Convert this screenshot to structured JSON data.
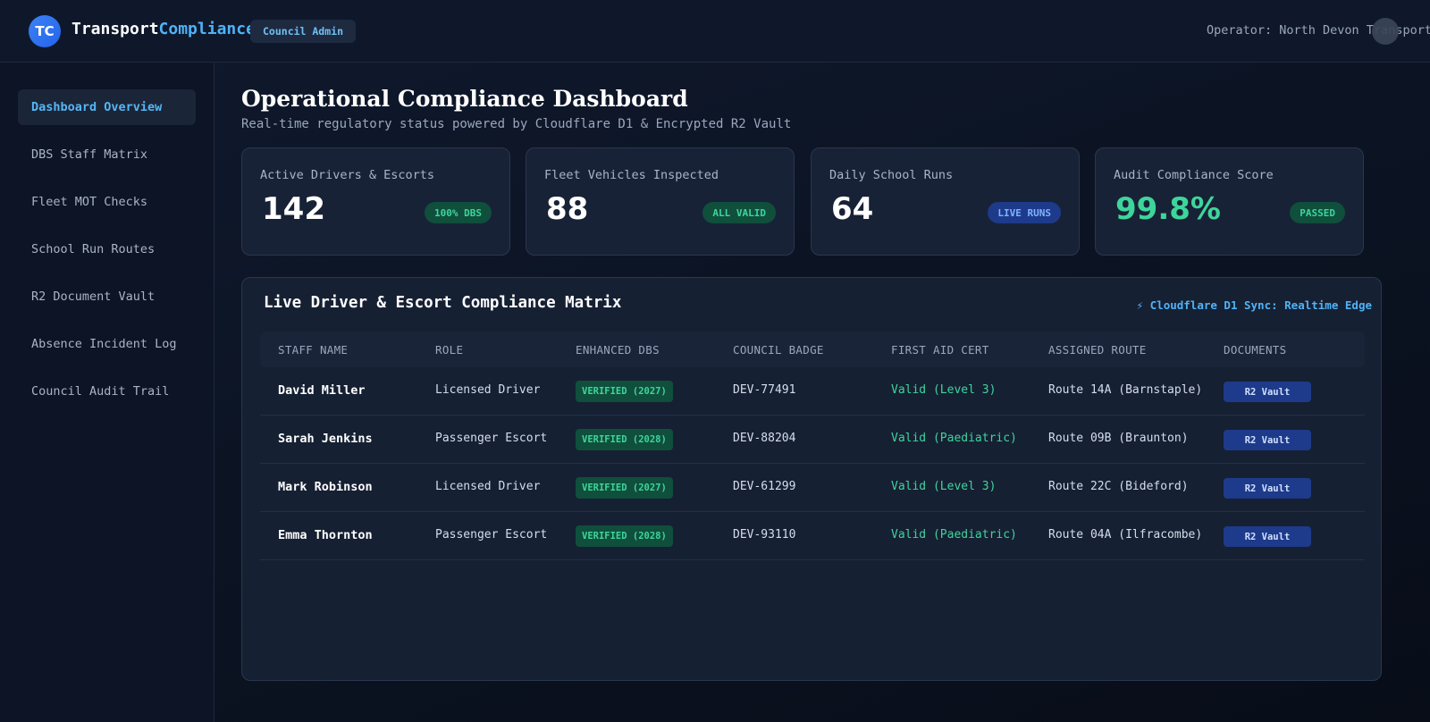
{
  "header": {
    "logo_initials": "TC",
    "brand_primary": "Transport",
    "brand_accent": "Compliance",
    "role_badge": "Council Admin",
    "operator": "Operator: North Devon Transport"
  },
  "sidebar": {
    "items": [
      {
        "label": "Dashboard Overview",
        "active": true
      },
      {
        "label": "DBS Staff Matrix",
        "active": false
      },
      {
        "label": "Fleet MOT Checks",
        "active": false
      },
      {
        "label": "School Run Routes",
        "active": false
      },
      {
        "label": "R2 Document Vault",
        "active": false
      },
      {
        "label": "Absence Incident Log",
        "active": false
      },
      {
        "label": "Council Audit Trail",
        "active": false
      }
    ]
  },
  "page": {
    "title": "Operational Compliance Dashboard",
    "subtitle": "Real-time regulatory status powered by Cloudflare D1 & Encrypted R2 Vault"
  },
  "stats": [
    {
      "label": "Active Drivers & Escorts",
      "value": "142",
      "badge": "100% DBS",
      "badge_color": "green"
    },
    {
      "label": "Fleet Vehicles Inspected",
      "value": "88",
      "badge": "ALL VALID",
      "badge_color": "green"
    },
    {
      "label": "Daily School Runs",
      "value": "64",
      "badge": "LIVE RUNS",
      "badge_color": "blue"
    },
    {
      "label": "Audit Compliance Score",
      "value": "99.8%",
      "badge": "PASSED",
      "badge_color": "green"
    }
  ],
  "matrix": {
    "title": "Live Driver & Escort Compliance Matrix",
    "sync_label": "⚡ Cloudflare D1 Sync: Realtime Edge",
    "columns": [
      "STAFF NAME",
      "ROLE",
      "ENHANCED DBS",
      "COUNCIL BADGE",
      "FIRST AID CERT",
      "ASSIGNED ROUTE",
      "DOCUMENTS"
    ],
    "rows": [
      {
        "name": "David Miller",
        "role": "Licensed Driver",
        "dbs": "VERIFIED (2027)",
        "badge": "DEV-77491",
        "first_aid": "Valid (Level 3)",
        "route": "Route 14A (Barnstaple)",
        "documents": "R2 Vault"
      },
      {
        "name": "Sarah Jenkins",
        "role": "Passenger Escort",
        "dbs": "VERIFIED (2028)",
        "badge": "DEV-88204",
        "first_aid": "Valid (Paediatric)",
        "route": "Route 09B (Braunton)",
        "documents": "R2 Vault"
      },
      {
        "name": "Mark Robinson",
        "role": "Licensed Driver",
        "dbs": "VERIFIED (2027)",
        "badge": "DEV-61299",
        "first_aid": "Valid (Level 3)",
        "route": "Route 22C (Bideford)",
        "documents": "R2 Vault"
      },
      {
        "name": "Emma Thornton",
        "role": "Passenger Escort",
        "dbs": "VERIFIED (2028)",
        "badge": "DEV-93110",
        "first_aid": "Valid (Paediatric)",
        "route": "Route 04A (Ilfracombe)",
        "documents": "R2 Vault"
      }
    ]
  },
  "colors": {
    "accent": "#4fb3f6",
    "success": "#3ed59b",
    "badge_blue": "#1e3a8a",
    "background": "#0c1424"
  }
}
